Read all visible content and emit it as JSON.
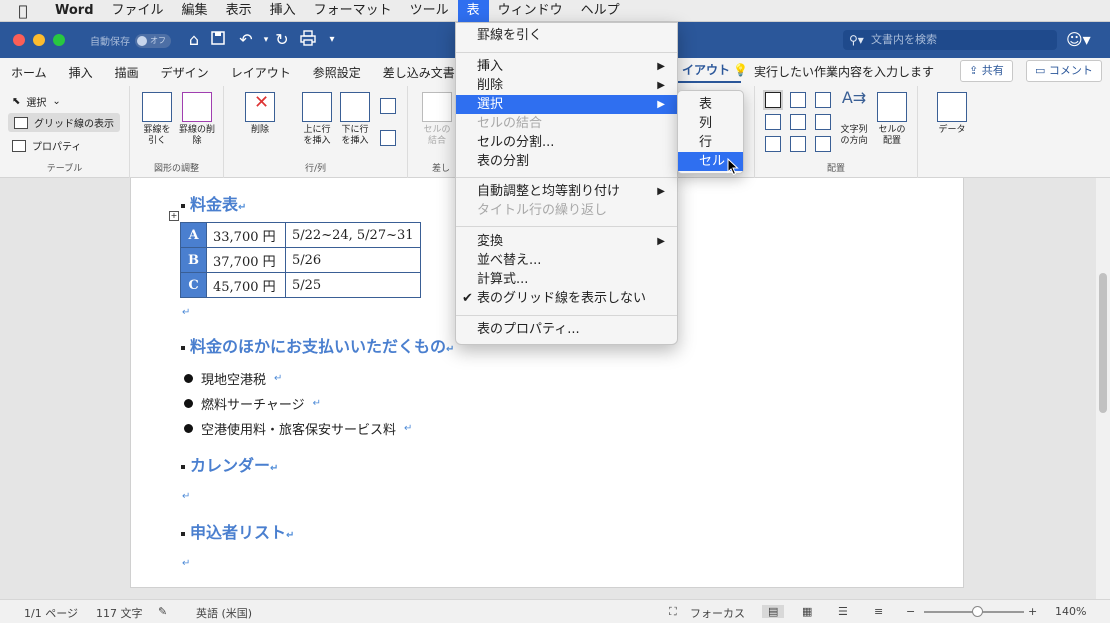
{
  "menubar": {
    "app": "Word",
    "items": [
      "ファイル",
      "編集",
      "表示",
      "挿入",
      "フォーマット",
      "ツール",
      "表",
      "ウィンドウ",
      "ヘルプ"
    ],
    "active": "表"
  },
  "titlebar": {
    "autosave_label": "自動保存",
    "autosave_state": "オフ",
    "search_placeholder": "文書内を検索"
  },
  "tabs": [
    "ホーム",
    "挿入",
    "描画",
    "デザイン",
    "レイアウト",
    "参照設定",
    "差し込み文書",
    "イアウト"
  ],
  "tellme": "実行したい作業内容を入力します",
  "share_label": "共有",
  "comment_label": "コメント",
  "ribbon": {
    "table_group": {
      "select": "選択",
      "gridlines": "グリッド線の表示",
      "properties": "プロパティ",
      "label": "テーブル"
    },
    "draw_group": {
      "draw": "罫線を引く",
      "erase": "罫線の削除",
      "label": "図形の調整"
    },
    "rows_group": {
      "delete": "削除",
      "insert_above": "上に行を挿入",
      "insert_below": "下に行を挿入",
      "label": "行/列"
    },
    "merge_group": {
      "merge": "セルの結合",
      "label": "差し"
    },
    "align_group": {
      "direction": "文字列の方向",
      "margins": "セルの配置",
      "label": "配置"
    },
    "data_group": {
      "data": "データ"
    }
  },
  "table_menu": {
    "items": [
      {
        "label": "罫線を引く",
        "disabled": false
      },
      {
        "label": "挿入",
        "submenu": true
      },
      {
        "label": "削除",
        "submenu": true
      },
      {
        "label": "選択",
        "submenu": true,
        "highlighted": true
      },
      {
        "label": "セルの結合",
        "disabled": true
      },
      {
        "label": "セルの分割...",
        "disabled": false
      },
      {
        "label": "表の分割",
        "disabled": false
      },
      {
        "label": "自動調整と均等割り付け",
        "submenu": true
      },
      {
        "label": "タイトル行の繰り返し",
        "disabled": true
      },
      {
        "label": "変換",
        "submenu": true
      },
      {
        "label": "並べ替え...",
        "disabled": false
      },
      {
        "label": "計算式...",
        "disabled": false
      },
      {
        "label": "表のグリッド線を表示しない",
        "checked": true
      },
      {
        "label": "表のプロパティ...",
        "disabled": false
      }
    ]
  },
  "select_submenu": {
    "items": [
      "表",
      "列",
      "行",
      "セル"
    ],
    "highlighted": "セル"
  },
  "document": {
    "heading1": "料金表",
    "table": [
      {
        "label": "A",
        "price": "33,700 円",
        "dates": "5/22~24, 5/27~31"
      },
      {
        "label": "B",
        "price": "37,700 円",
        "dates": "5/26"
      },
      {
        "label": "C",
        "price": "45,700 円",
        "dates": "5/25"
      }
    ],
    "heading2": "料金のほかにお支払いいただくもの",
    "bullets": [
      "現地空港税",
      "燃料サーチャージ",
      "空港使用料・旅客保安サービス料"
    ],
    "heading3": "カレンダー",
    "heading4": "申込者リスト"
  },
  "status": {
    "page": "1/1 ページ",
    "words": "117 文字",
    "language": "英語 (米国)",
    "focus": "フォーカス",
    "zoom": "140%"
  },
  "colors": {
    "brand": "#2b579a",
    "highlight": "#2f6ff0",
    "heading": "#4a7fcf"
  }
}
